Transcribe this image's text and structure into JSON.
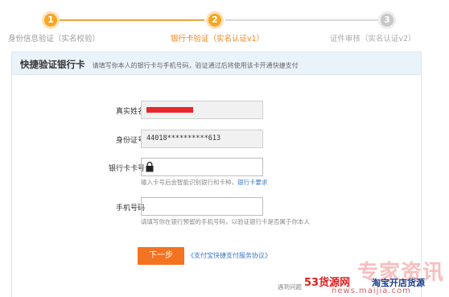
{
  "steps": [
    {
      "number": "1",
      "label": "身份信息验证（实名校验）",
      "state": "done"
    },
    {
      "number": "2",
      "label": "银行卡验证（实名认证v1）",
      "state": "active"
    },
    {
      "number": "3",
      "label": "证件审核（实名认证v2）",
      "state": "pending"
    }
  ],
  "panel": {
    "title": "快捷验证银行卡",
    "subtitle": "请填写你本人的银行卡与手机号码，验证通过后将使用该卡开通快捷支付"
  },
  "form": {
    "name_label": "真实姓名",
    "id_label": "身份证号",
    "id_value": "44018**********613",
    "card_label": "银行卡卡号",
    "card_hint": "输入卡号后会智能识别银行和卡种，",
    "card_hint_link": "银行卡要求",
    "phone_label": "手机号码",
    "phone_hint": "请填写你在银行预留的手机号码，以验证银行卡是否属于你本人"
  },
  "actions": {
    "next_label": "下一步",
    "agreement_link": "《支付宝快捷支付服务协议》",
    "help_text": "遇到问题"
  },
  "watermark": {
    "big": "专家资讯",
    "mid": "53货源网",
    "mid2": "淘宝开店货源",
    "url": "news.maijia.com"
  },
  "colors": {
    "accent": "#f6a623",
    "button": "#f37321",
    "link": "#3b79c7",
    "masked_name": "#e8272c"
  }
}
